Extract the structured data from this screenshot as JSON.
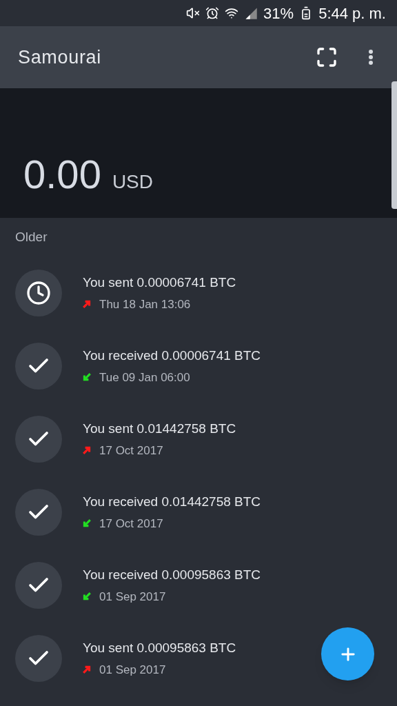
{
  "status_bar": {
    "battery": "31%",
    "time": "5:44 p. m."
  },
  "app_bar": {
    "title": "Samourai"
  },
  "balance": {
    "amount": "0.00",
    "currency": "USD"
  },
  "section": {
    "title": "Older"
  },
  "transactions": [
    {
      "pending": true,
      "outgoing": true,
      "text": "You sent 0.00006741 BTC",
      "date": "Thu 18 Jan 13:06"
    },
    {
      "pending": false,
      "outgoing": false,
      "text": "You received 0.00006741 BTC",
      "date": "Tue 09 Jan 06:00"
    },
    {
      "pending": false,
      "outgoing": true,
      "text": "You sent 0.01442758 BTC",
      "date": "17 Oct 2017"
    },
    {
      "pending": false,
      "outgoing": false,
      "text": "You received 0.01442758 BTC",
      "date": "17 Oct 2017"
    },
    {
      "pending": false,
      "outgoing": false,
      "text": "You received 0.00095863 BTC",
      "date": "01 Sep 2017"
    },
    {
      "pending": false,
      "outgoing": true,
      "text": "You sent 0.00095863 BTC",
      "date": "01 Sep 2017"
    }
  ]
}
